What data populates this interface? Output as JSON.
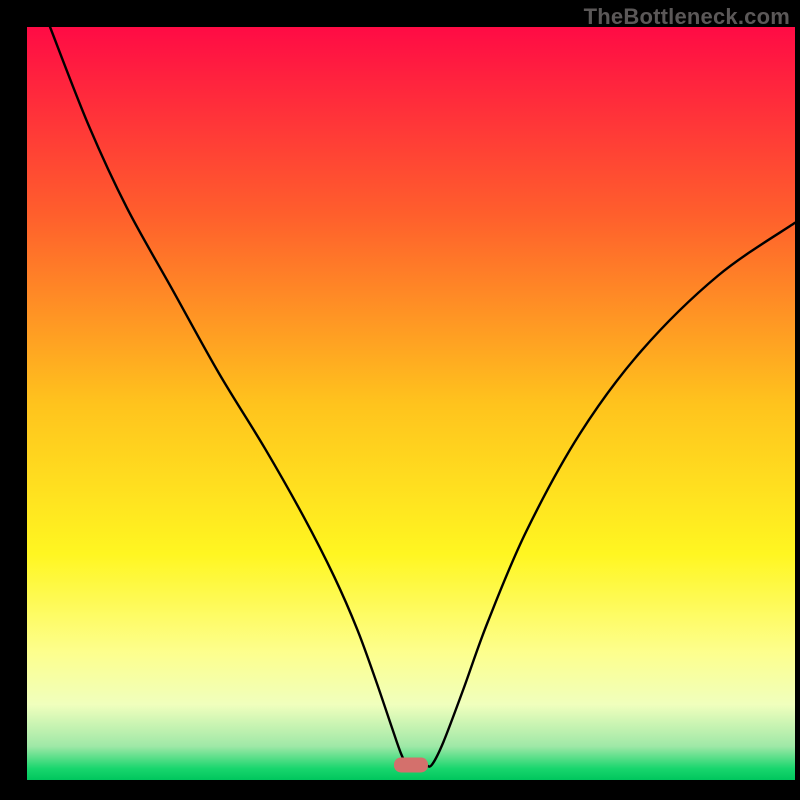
{
  "watermark": "TheBottleneck.com",
  "chart_data": {
    "type": "line",
    "title": "",
    "xlabel": "",
    "ylabel": "",
    "xlim": [
      0,
      100
    ],
    "ylim": [
      0,
      100
    ],
    "background": {
      "type": "vertical-gradient",
      "stops": [
        {
          "pos": 0.0,
          "color": "#ff0b45"
        },
        {
          "pos": 0.25,
          "color": "#ff5f2c"
        },
        {
          "pos": 0.5,
          "color": "#ffc31d"
        },
        {
          "pos": 0.7,
          "color": "#fff621"
        },
        {
          "pos": 0.83,
          "color": "#fdff8d"
        },
        {
          "pos": 0.9,
          "color": "#f0ffbd"
        },
        {
          "pos": 0.955,
          "color": "#9fe8a7"
        },
        {
          "pos": 0.985,
          "color": "#18d66d"
        },
        {
          "pos": 1.0,
          "color": "#00c65d"
        }
      ]
    },
    "marker": {
      "x": 50,
      "y": 2,
      "color": "#d4706c",
      "shape": "rounded-rect"
    },
    "series": [
      {
        "name": "bottleneck-curve",
        "color": "#000000",
        "x": [
          3,
          8,
          13,
          19,
          25,
          31,
          36,
          40,
          43,
          45.5,
          47.5,
          48.7,
          49.5,
          50.3,
          51.1,
          51.9,
          52.7,
          54.2,
          56.8,
          60,
          65,
          72,
          80,
          90,
          100
        ],
        "values": [
          100,
          87,
          76,
          65,
          54,
          44,
          35,
          27,
          20,
          13,
          7,
          3.5,
          2,
          2,
          2,
          2,
          2,
          5,
          12,
          21,
          33,
          46,
          57,
          67,
          74
        ]
      }
    ]
  }
}
